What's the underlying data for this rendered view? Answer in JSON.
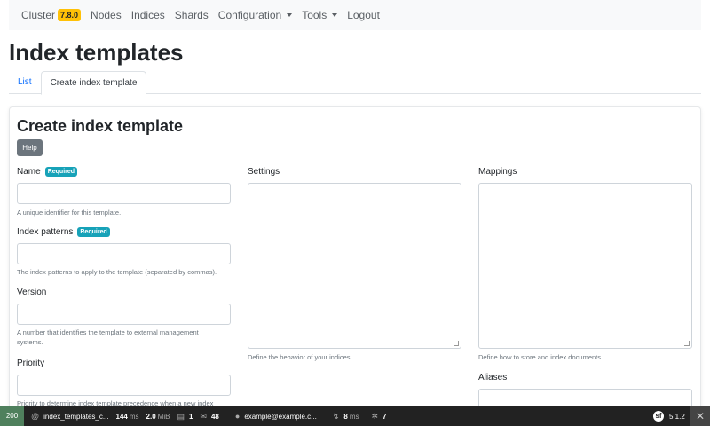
{
  "navbar": {
    "cluster_label": "Cluster",
    "cluster_version": "7.8.0",
    "items": [
      "Nodes",
      "Indices",
      "Shards"
    ],
    "configuration_label": "Configuration",
    "tools_label": "Tools",
    "logout_label": "Logout"
  },
  "page": {
    "title": "Index templates"
  },
  "tabs": {
    "list": "List",
    "create": "Create index template"
  },
  "card": {
    "title": "Create index template",
    "help_label": "Help"
  },
  "form": {
    "required_badge": "Required",
    "name": {
      "label": "Name",
      "value": "",
      "hint": "A unique identifier for this template."
    },
    "index_patterns": {
      "label": "Index patterns",
      "value": "",
      "hint": "The index patterns to apply to the template (separated by commas)."
    },
    "version": {
      "label": "Version",
      "value": "",
      "hint_line1": "A number that identifies the template to external management",
      "hint_line2": "systems."
    },
    "priority": {
      "label": "Priority",
      "value": "",
      "hint": "Priority to determine index template precedence when a new index"
    },
    "settings": {
      "label": "Settings",
      "value": "",
      "hint": "Define the behavior of your indices."
    },
    "mappings": {
      "label": "Mappings",
      "value": "",
      "hint": "Define how to store and index documents."
    },
    "aliases": {
      "label": "Aliases",
      "value": ""
    }
  },
  "debugbar": {
    "status": "200",
    "route": "index_templates_c...",
    "time_value": "144",
    "time_unit": "ms",
    "memory_value": "2.0",
    "memory_unit": "MiB",
    "forms_count": "1",
    "translations_count": "48",
    "user": "example@example.c...",
    "events_value": "8",
    "events_unit": "ms",
    "services_count": "7",
    "symfony_version": "5.1.2"
  }
}
